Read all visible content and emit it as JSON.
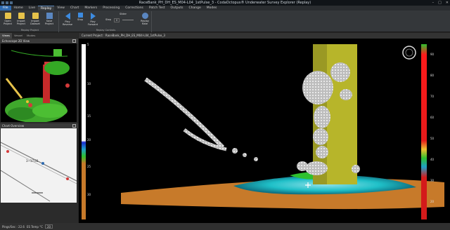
{
  "window": {
    "title": "RaceBank_PH_DH_ES_M04-L04_1stPulse_3 - CodaOctopus® Underwater Survey Explorer (Replay)",
    "controls": [
      "–",
      "□",
      "✕"
    ]
  },
  "menu": {
    "file": "File",
    "tabs": [
      "Home",
      "Live",
      "Replay",
      "View",
      "Chart",
      "Markers",
      "Processing",
      "Corrections",
      "Patch Test",
      "Outputs",
      "Change",
      "Modes"
    ],
    "active": "Replay"
  },
  "ribbon": {
    "project_group": {
      "label": "Replay Project",
      "buttons": [
        "Open Project",
        "Import Project",
        "Import Dataset",
        "Save Project"
      ]
    },
    "controls_group": {
      "label": "Replay Controls",
      "buttons": [
        "Play Reverse",
        "Stop",
        "Play Forward"
      ],
      "slider_title": "Slider",
      "step_label": "Step",
      "step_value": "0",
      "rate_label": "Replay Rate"
    }
  },
  "left_pane": {
    "tabs": [
      "Views",
      "Vessel",
      "Modes"
    ],
    "active_tab": "Views",
    "view2d_title": "Echoscope 2D View",
    "chart_title": "Chart Overview",
    "chart_label": "3~17.03"
  },
  "main": {
    "header": "Current Project : RaceBank_PH_DH_ES_M04-L04_1stPulse_3",
    "left_scale": [
      "5",
      "10",
      "15",
      "20",
      "25",
      "30"
    ],
    "right_scale": [
      "90",
      "80",
      "70",
      "60",
      "50",
      "40",
      "30",
      "20"
    ]
  },
  "status": {
    "ping_label": "Pings/Sec : 22.6",
    "temp_label": "ES Temp °C",
    "temp_value": "20"
  },
  "colors": {
    "accent": "#2f6bb0",
    "seabed": "#c77a2a",
    "monopile": "#b7b52a",
    "scour": "#1fc0c8"
  }
}
